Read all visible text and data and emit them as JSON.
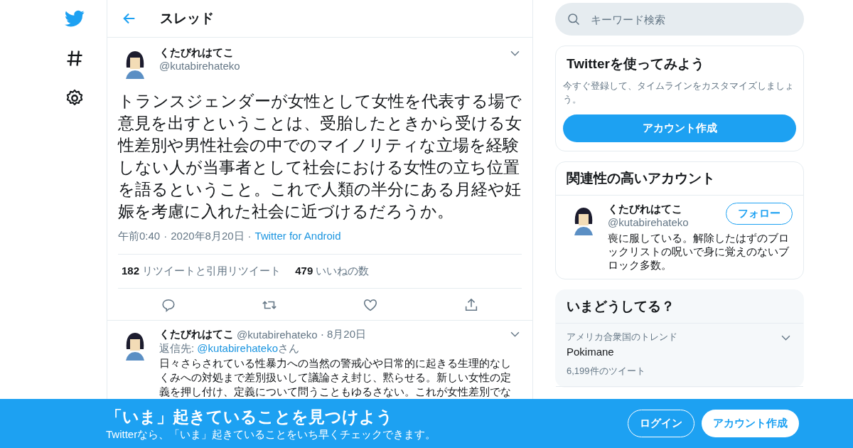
{
  "header": {
    "title": "スレッド"
  },
  "tweet": {
    "name": "くたびれはてこ",
    "handle": "@kutabirehateko",
    "text": "トランスジェンダーが女性として女性を代表する場で意見を出すということは、受胎したときから受ける女性差別や男性社会の中でのマイノリティな立場を経験しない人が当事者として社会における女性の立ち位置を語るということ。これで人類の半分にある月経や妊娠を考慮に入れた社会に近づけるだろうか。",
    "time": "午前0:40",
    "date": "2020年8月20日",
    "source": "Twitter for Android",
    "separators": [
      "·",
      "·"
    ],
    "stats": [
      {
        "count": "182",
        "label": "リツイートと引用リツイート"
      },
      {
        "count": "479",
        "label": "いいねの数"
      }
    ]
  },
  "reply": {
    "name": "くたびれはてこ",
    "handle": "@kutabirehateko",
    "separator": "·",
    "date": "8月20日",
    "reply_to_label": "返信先:",
    "reply_to_handle": "@kutabirehateko",
    "reply_to_suffix": "さん",
    "text": "日々さらされている性暴力への当然の警戒心や日常的に起きる生理的なしくみへの対処まで差別扱いして議論さえ封じ、黙らせる。新しい女性の定義を押し付け、定義について問うこともゆるさない。これが女性差別でな"
  },
  "search": {
    "placeholder": "キーワード検索"
  },
  "signup_card": {
    "title": "Twitterを使ってみよう",
    "text": "今すぐ登録して、タイムラインをカスタマイズしましょう。",
    "button": "アカウント作成"
  },
  "related_card": {
    "title": "関連性の高いアカウント",
    "name": "くたびれはてこ",
    "handle": "@kutabirehateko",
    "bio": "喪に服している。解除したはずのブロックリストの呪いで身に覚えのないブロック多数。",
    "button": "フォロー"
  },
  "trends_card": {
    "title": "いまどうしてる？",
    "trends": [
      {
        "context": "アメリカ合衆国のトレンド",
        "name": "Pokimane",
        "count": "6,199件のツイート"
      }
    ]
  },
  "banner": {
    "title": "「いま」起きていることを見つけよう",
    "subtitle": "Twitterなら、「いま」起きていることをいち早くチェックできます。",
    "login": "ログイン",
    "signup": "アカウント作成"
  }
}
